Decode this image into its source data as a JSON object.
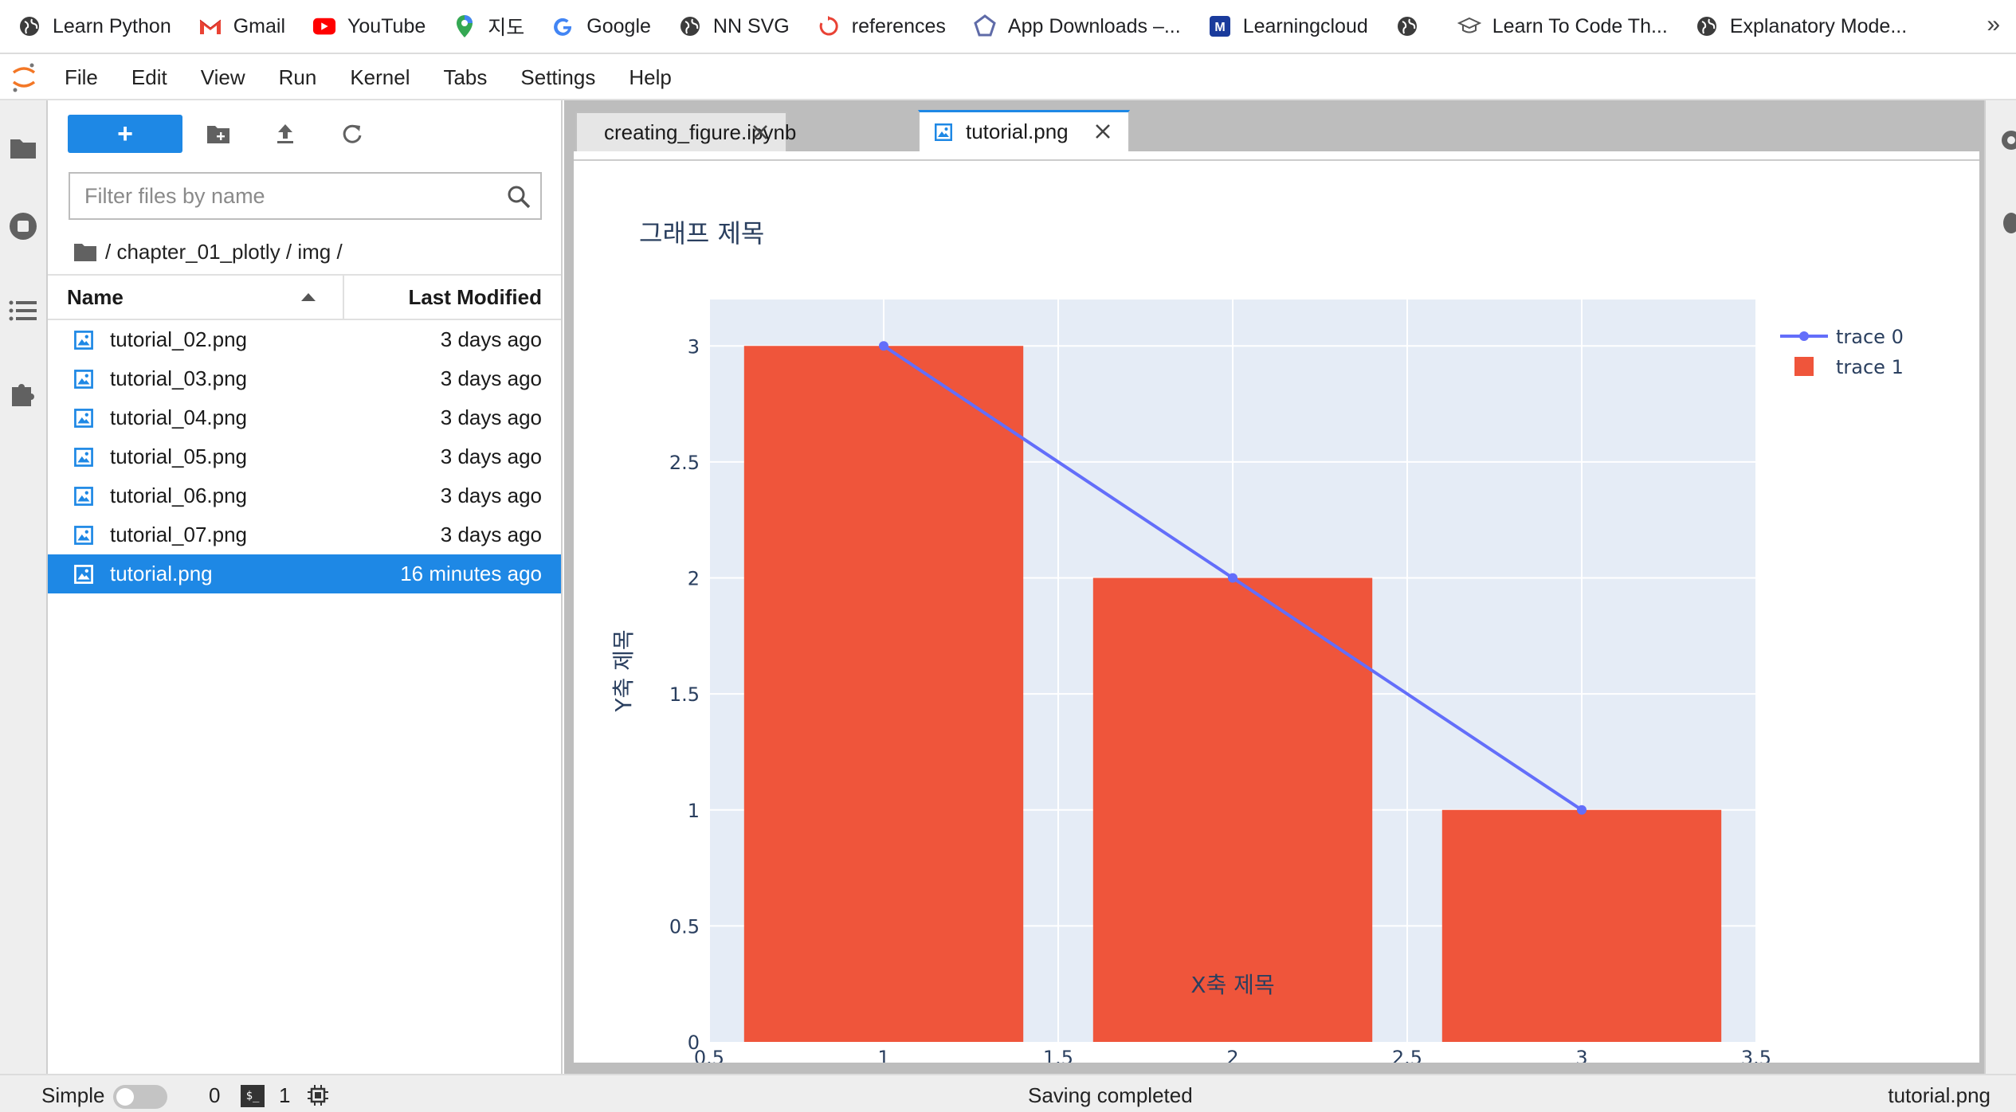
{
  "bookmarks": [
    {
      "label": "Learn Python",
      "icon": "globe-icon"
    },
    {
      "label": "Gmail",
      "icon": "gmail-icon"
    },
    {
      "label": "YouTube",
      "icon": "youtube-icon"
    },
    {
      "label": "지도",
      "icon": "maps-pin-icon"
    },
    {
      "label": "Google",
      "icon": "google-icon"
    },
    {
      "label": "NN SVG",
      "icon": "globe-icon"
    },
    {
      "label": "references",
      "icon": "refresh-red-icon"
    },
    {
      "label": "App Downloads –...",
      "icon": "pentagon-icon"
    },
    {
      "label": "Learningcloud",
      "icon": "m-badge-icon"
    },
    {
      "label": "",
      "icon": "globe-icon"
    },
    {
      "label": "Learn To Code Th...",
      "icon": "graduation-cap-icon"
    },
    {
      "label": "Explanatory Mode...",
      "icon": "globe-icon"
    }
  ],
  "bookmarks_more": "»",
  "menu": [
    "File",
    "Edit",
    "View",
    "Run",
    "Kernel",
    "Tabs",
    "Settings",
    "Help"
  ],
  "filebrowser": {
    "new_label": "+",
    "filter_placeholder": "Filter files by name",
    "breadcrumb": "/ chapter_01_plotly / img /",
    "col_name": "Name",
    "col_modified": "Last Modified",
    "files": [
      {
        "name": "tutorial_02.png",
        "modified": "3 days ago",
        "selected": false
      },
      {
        "name": "tutorial_03.png",
        "modified": "3 days ago",
        "selected": false
      },
      {
        "name": "tutorial_04.png",
        "modified": "3 days ago",
        "selected": false
      },
      {
        "name": "tutorial_05.png",
        "modified": "3 days ago",
        "selected": false
      },
      {
        "name": "tutorial_06.png",
        "modified": "3 days ago",
        "selected": false
      },
      {
        "name": "tutorial_07.png",
        "modified": "3 days ago",
        "selected": false
      },
      {
        "name": "tutorial.png",
        "modified": "16 minutes ago",
        "selected": true
      }
    ]
  },
  "tabs": [
    {
      "label": "creating_figure.ipynb",
      "active": false
    },
    {
      "label": "tutorial.png",
      "active": true
    }
  ],
  "chart_data": {
    "type": "bar",
    "title": "그래프 제목",
    "xlabel": "X축 제목",
    "ylabel": "Y축 제목",
    "xlim": [
      0.5,
      3.5
    ],
    "ylim": [
      0,
      3.2
    ],
    "xticks": [
      "0.5",
      "1",
      "1.5",
      "2",
      "2.5",
      "3",
      "3.5"
    ],
    "yticks": [
      "0",
      "0.5",
      "1",
      "1.5",
      "2",
      "2.5",
      "3"
    ],
    "grid": true,
    "legend": "top-right",
    "series": [
      {
        "name": "trace 0",
        "kind": "line",
        "x": [
          1,
          2,
          3
        ],
        "y": [
          3,
          2,
          1
        ],
        "color": "#636efa"
      },
      {
        "name": "trace 1",
        "kind": "bar",
        "x": [
          1,
          2,
          3
        ],
        "y": [
          3,
          2,
          1
        ],
        "color": "#ef553b"
      }
    ],
    "plot_bg": "#e5ecf6"
  },
  "status": {
    "mode": "Simple",
    "kernels": "0",
    "terminal_glyph": "$_",
    "terminals": "1",
    "message": "Saving completed",
    "current_file": "tutorial.png"
  },
  "colors": {
    "accent": "#1e88e5",
    "selection": "#1e88e5"
  }
}
